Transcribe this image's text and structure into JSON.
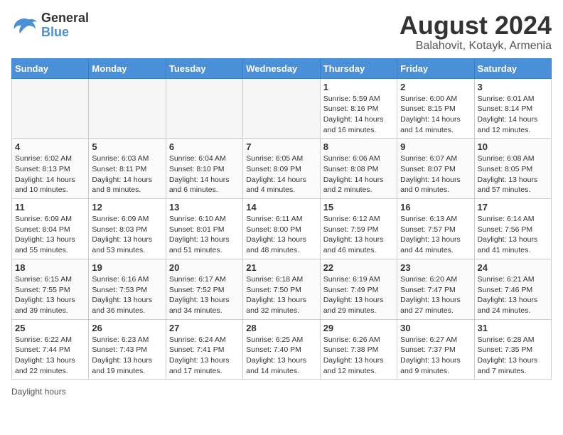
{
  "logo": {
    "line1": "General",
    "line2": "Blue"
  },
  "title": "August 2024",
  "subtitle": "Balahovit, Kotayk, Armenia",
  "days_header": [
    "Sunday",
    "Monday",
    "Tuesday",
    "Wednesday",
    "Thursday",
    "Friday",
    "Saturday"
  ],
  "weeks": [
    [
      {
        "day": "",
        "info": ""
      },
      {
        "day": "",
        "info": ""
      },
      {
        "day": "",
        "info": ""
      },
      {
        "day": "",
        "info": ""
      },
      {
        "day": "1",
        "info": "Sunrise: 5:59 AM\nSunset: 8:16 PM\nDaylight: 14 hours\nand 16 minutes."
      },
      {
        "day": "2",
        "info": "Sunrise: 6:00 AM\nSunset: 8:15 PM\nDaylight: 14 hours\nand 14 minutes."
      },
      {
        "day": "3",
        "info": "Sunrise: 6:01 AM\nSunset: 8:14 PM\nDaylight: 14 hours\nand 12 minutes."
      }
    ],
    [
      {
        "day": "4",
        "info": "Sunrise: 6:02 AM\nSunset: 8:13 PM\nDaylight: 14 hours\nand 10 minutes."
      },
      {
        "day": "5",
        "info": "Sunrise: 6:03 AM\nSunset: 8:11 PM\nDaylight: 14 hours\nand 8 minutes."
      },
      {
        "day": "6",
        "info": "Sunrise: 6:04 AM\nSunset: 8:10 PM\nDaylight: 14 hours\nand 6 minutes."
      },
      {
        "day": "7",
        "info": "Sunrise: 6:05 AM\nSunset: 8:09 PM\nDaylight: 14 hours\nand 4 minutes."
      },
      {
        "day": "8",
        "info": "Sunrise: 6:06 AM\nSunset: 8:08 PM\nDaylight: 14 hours\nand 2 minutes."
      },
      {
        "day": "9",
        "info": "Sunrise: 6:07 AM\nSunset: 8:07 PM\nDaylight: 14 hours\nand 0 minutes."
      },
      {
        "day": "10",
        "info": "Sunrise: 6:08 AM\nSunset: 8:05 PM\nDaylight: 13 hours\nand 57 minutes."
      }
    ],
    [
      {
        "day": "11",
        "info": "Sunrise: 6:09 AM\nSunset: 8:04 PM\nDaylight: 13 hours\nand 55 minutes."
      },
      {
        "day": "12",
        "info": "Sunrise: 6:09 AM\nSunset: 8:03 PM\nDaylight: 13 hours\nand 53 minutes."
      },
      {
        "day": "13",
        "info": "Sunrise: 6:10 AM\nSunset: 8:01 PM\nDaylight: 13 hours\nand 51 minutes."
      },
      {
        "day": "14",
        "info": "Sunrise: 6:11 AM\nSunset: 8:00 PM\nDaylight: 13 hours\nand 48 minutes."
      },
      {
        "day": "15",
        "info": "Sunrise: 6:12 AM\nSunset: 7:59 PM\nDaylight: 13 hours\nand 46 minutes."
      },
      {
        "day": "16",
        "info": "Sunrise: 6:13 AM\nSunset: 7:57 PM\nDaylight: 13 hours\nand 44 minutes."
      },
      {
        "day": "17",
        "info": "Sunrise: 6:14 AM\nSunset: 7:56 PM\nDaylight: 13 hours\nand 41 minutes."
      }
    ],
    [
      {
        "day": "18",
        "info": "Sunrise: 6:15 AM\nSunset: 7:55 PM\nDaylight: 13 hours\nand 39 minutes."
      },
      {
        "day": "19",
        "info": "Sunrise: 6:16 AM\nSunset: 7:53 PM\nDaylight: 13 hours\nand 36 minutes."
      },
      {
        "day": "20",
        "info": "Sunrise: 6:17 AM\nSunset: 7:52 PM\nDaylight: 13 hours\nand 34 minutes."
      },
      {
        "day": "21",
        "info": "Sunrise: 6:18 AM\nSunset: 7:50 PM\nDaylight: 13 hours\nand 32 minutes."
      },
      {
        "day": "22",
        "info": "Sunrise: 6:19 AM\nSunset: 7:49 PM\nDaylight: 13 hours\nand 29 minutes."
      },
      {
        "day": "23",
        "info": "Sunrise: 6:20 AM\nSunset: 7:47 PM\nDaylight: 13 hours\nand 27 minutes."
      },
      {
        "day": "24",
        "info": "Sunrise: 6:21 AM\nSunset: 7:46 PM\nDaylight: 13 hours\nand 24 minutes."
      }
    ],
    [
      {
        "day": "25",
        "info": "Sunrise: 6:22 AM\nSunset: 7:44 PM\nDaylight: 13 hours\nand 22 minutes."
      },
      {
        "day": "26",
        "info": "Sunrise: 6:23 AM\nSunset: 7:43 PM\nDaylight: 13 hours\nand 19 minutes."
      },
      {
        "day": "27",
        "info": "Sunrise: 6:24 AM\nSunset: 7:41 PM\nDaylight: 13 hours\nand 17 minutes."
      },
      {
        "day": "28",
        "info": "Sunrise: 6:25 AM\nSunset: 7:40 PM\nDaylight: 13 hours\nand 14 minutes."
      },
      {
        "day": "29",
        "info": "Sunrise: 6:26 AM\nSunset: 7:38 PM\nDaylight: 13 hours\nand 12 minutes."
      },
      {
        "day": "30",
        "info": "Sunrise: 6:27 AM\nSunset: 7:37 PM\nDaylight: 13 hours\nand 9 minutes."
      },
      {
        "day": "31",
        "info": "Sunrise: 6:28 AM\nSunset: 7:35 PM\nDaylight: 13 hours\nand 7 minutes."
      }
    ]
  ],
  "footer": "Daylight hours"
}
